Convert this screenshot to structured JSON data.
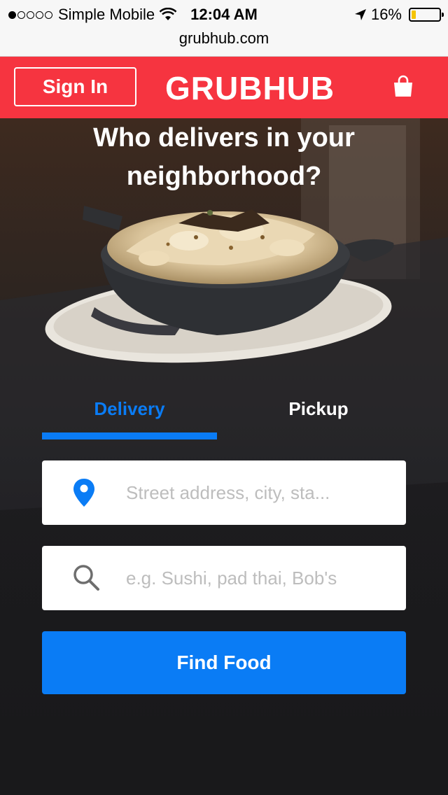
{
  "status_bar": {
    "carrier": "Simple Mobile",
    "time": "12:04 AM",
    "battery_percent": "16%",
    "battery_level": 0.16,
    "signal_bars_filled": 1,
    "signal_bars_total": 5
  },
  "browser": {
    "url": "grubhub.com"
  },
  "header": {
    "sign_in_label": "Sign In",
    "logo_text": "GRUBHUB",
    "brand_color": "#f63440"
  },
  "hero": {
    "headline_line1": "Who delivers in your",
    "headline_line2": "neighborhood?"
  },
  "tabs": [
    {
      "label": "Delivery",
      "active": true
    },
    {
      "label": "Pickup",
      "active": false
    }
  ],
  "search": {
    "address_placeholder": "Street address, city, sta...",
    "food_placeholder": "e.g. Sushi, pad thai, Bob's"
  },
  "find_button_label": "Find Food",
  "colors": {
    "accent": "#0a7cf5",
    "header": "#f63440"
  }
}
